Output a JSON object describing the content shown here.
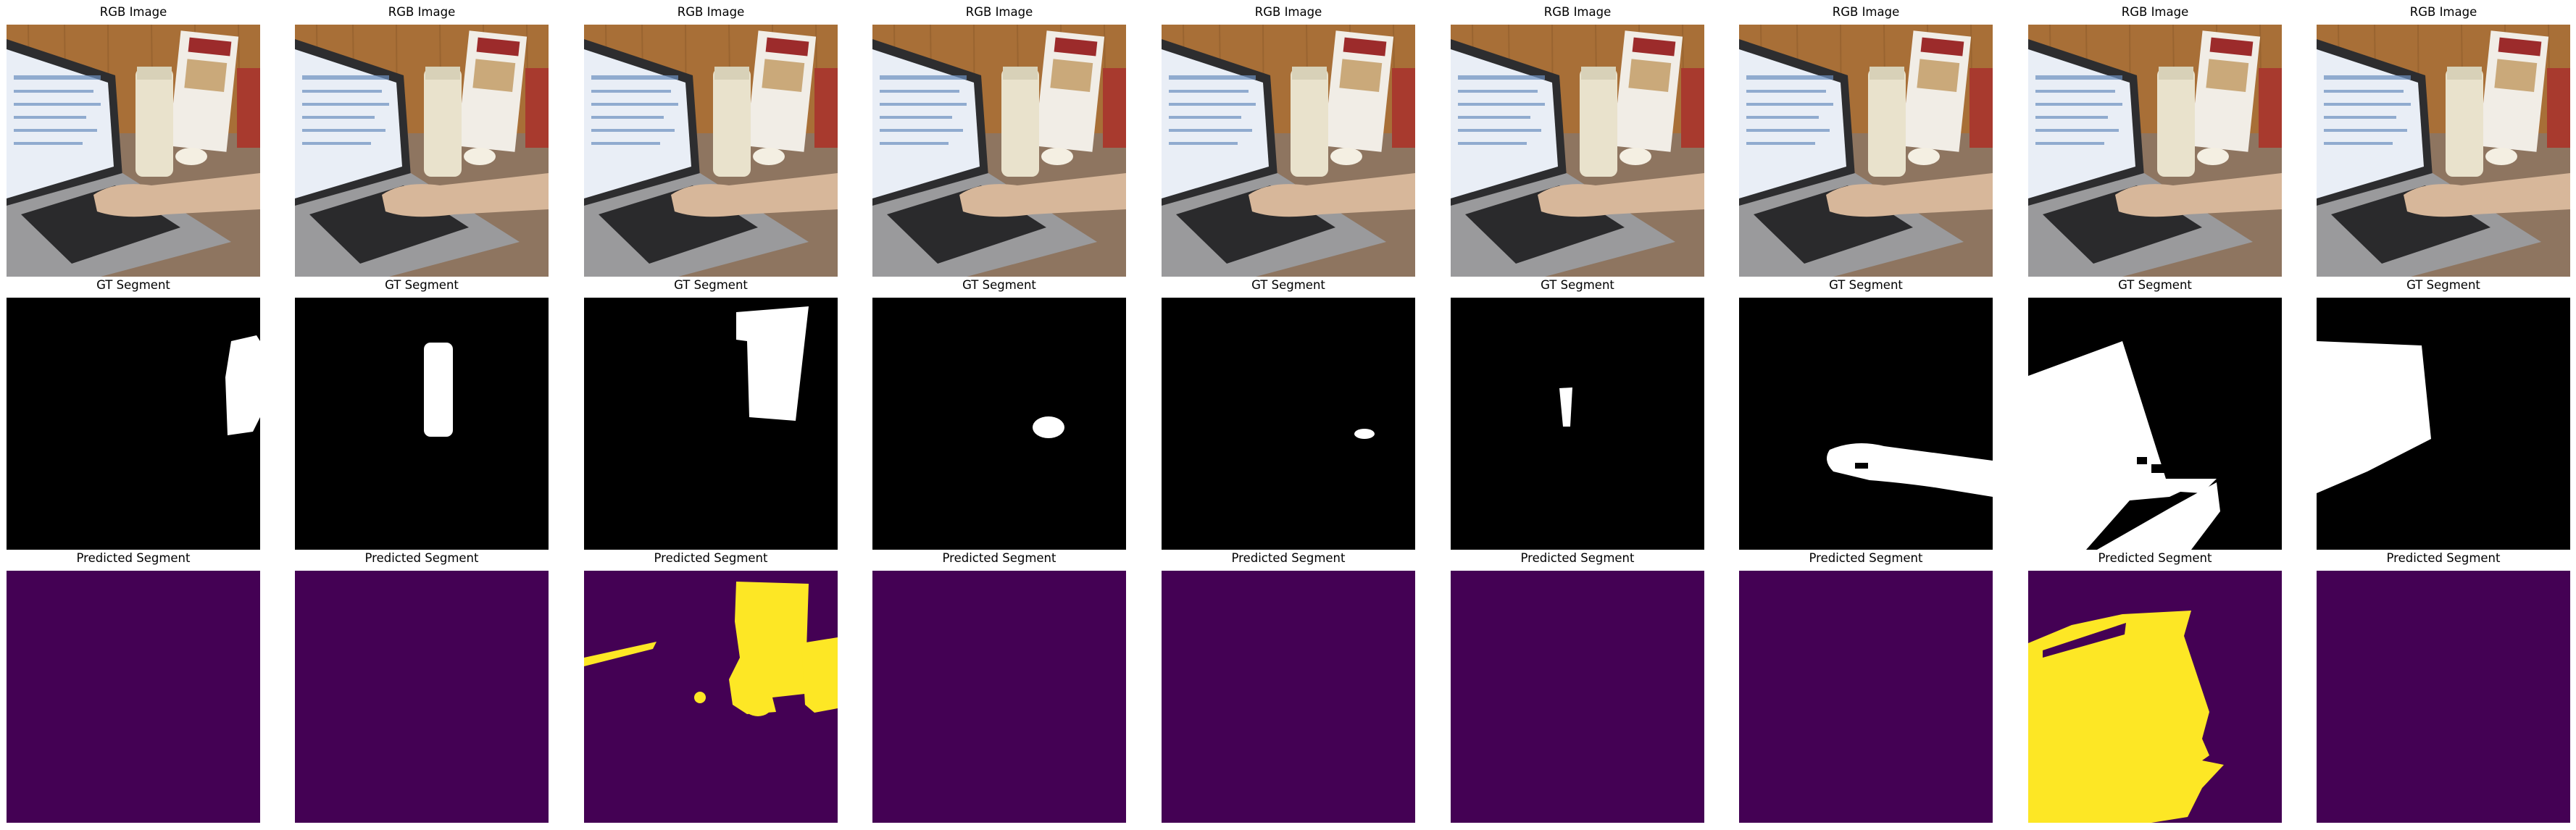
{
  "grid": {
    "columns": 9,
    "rows": [
      {
        "kind": "rgb",
        "title": "RGB Image"
      },
      {
        "kind": "gt",
        "title": "GT Segment"
      },
      {
        "kind": "pred",
        "title": "Predicted Segment"
      }
    ]
  },
  "colors": {
    "background": "#ffffff",
    "gt_background": "#000000",
    "gt_foreground": "#ffffff",
    "pred_background": "#440154",
    "pred_foreground": "#fde725",
    "wood": "#a86f37",
    "counter": "#8a6e52",
    "laptop_body": "#9a9a9c",
    "screen": "#e9eef6",
    "skin": "#d7b79a",
    "cup": "#e9e2cc"
  },
  "panels": [
    {
      "col": 0,
      "gt": "edge-right",
      "pred": "empty"
    },
    {
      "col": 1,
      "gt": "tumbler",
      "pred": "empty"
    },
    {
      "col": 2,
      "gt": "flyer",
      "pred": "multi"
    },
    {
      "col": 3,
      "gt": "cup-small",
      "pred": "empty"
    },
    {
      "col": 4,
      "gt": "tiny-spot",
      "pred": "empty"
    },
    {
      "col": 5,
      "gt": "small-object",
      "pred": "empty"
    },
    {
      "col": 6,
      "gt": "arm",
      "pred": "empty"
    },
    {
      "col": 7,
      "gt": "laptop",
      "pred": "laptop"
    },
    {
      "col": 8,
      "gt": "screen",
      "pred": "empty"
    }
  ]
}
